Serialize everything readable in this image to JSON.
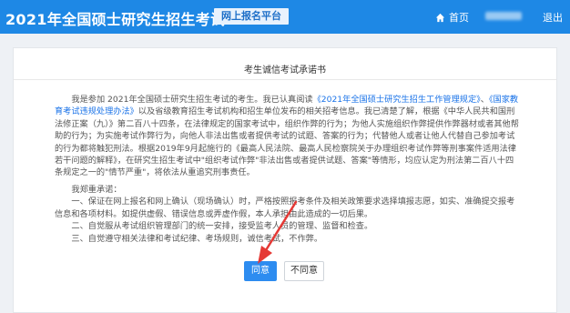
{
  "header": {
    "app_title": "2021年全国硕士研究生招生考试",
    "platform_badge": "网上报名平台",
    "home_label": "首页",
    "logout_label": "退出"
  },
  "page": {
    "title": "考生诚信考试承诺书",
    "para1": {
      "t1": "我是参加 2021年全国硕士研究生招生考试的考生。我已认真阅读",
      "link1": "《2021年全国硕士研究生招生工作管理规定》",
      "t2": "、",
      "link2": "《国家教育考试违规处理办法》",
      "t3": "以及省级教育招生考试机构和招生单位发布的相关招考信息。我已清楚了解，根据《中华人民共和国刑法修正案（九）》第二百八十四条，在法律规定的国家考试中，组织作弊的行为；为他人实施组织作弊提供作弊器材或者其他帮助的行为；为实施考试作弊行为，向他人非法出售或者提供考试的试题、答案的行为；代替他人或者让他人代替自己参加考试的行为都将触犯刑法。根据2019年9月起施行的《最高人民法院、最高人民检察院关于办理组织考试作弊等刑事案件适用法律若干问题的解释》，在研究生招生考试中\"组织考试作弊\"非法出售或者提供试题、答案\"等情形，均应认定为刑法第二百八十四条规定之一的\"情节严重\"，将依法从重追究刑事责任。"
    },
    "pledge": {
      "intro": "我郑重承诺：",
      "item1": "一、保证在网上报名和网上确认（现场确认）时，严格按照报考条件及相关政策要求选择填报志愿，如实、准确提交报考信息和各项材料。如提供虚假、错误信息或弄虚作假，本人承担由此造成的一切后果。",
      "item2": "二、自觉服从考试组织管理部门的统一安排，接受监考人员的管理、监督和检查。",
      "item3": "三、自觉遵守相关法律和考试纪律、考场规则，诚信考试，不作弊。"
    },
    "buttons": {
      "agree": "同意",
      "disagree": "不同意"
    }
  },
  "colors": {
    "header_bg": "#1e88e5",
    "primary_button": "#2d8cf0",
    "link": "#1a73e8",
    "annotation_arrow": "#e53935"
  }
}
